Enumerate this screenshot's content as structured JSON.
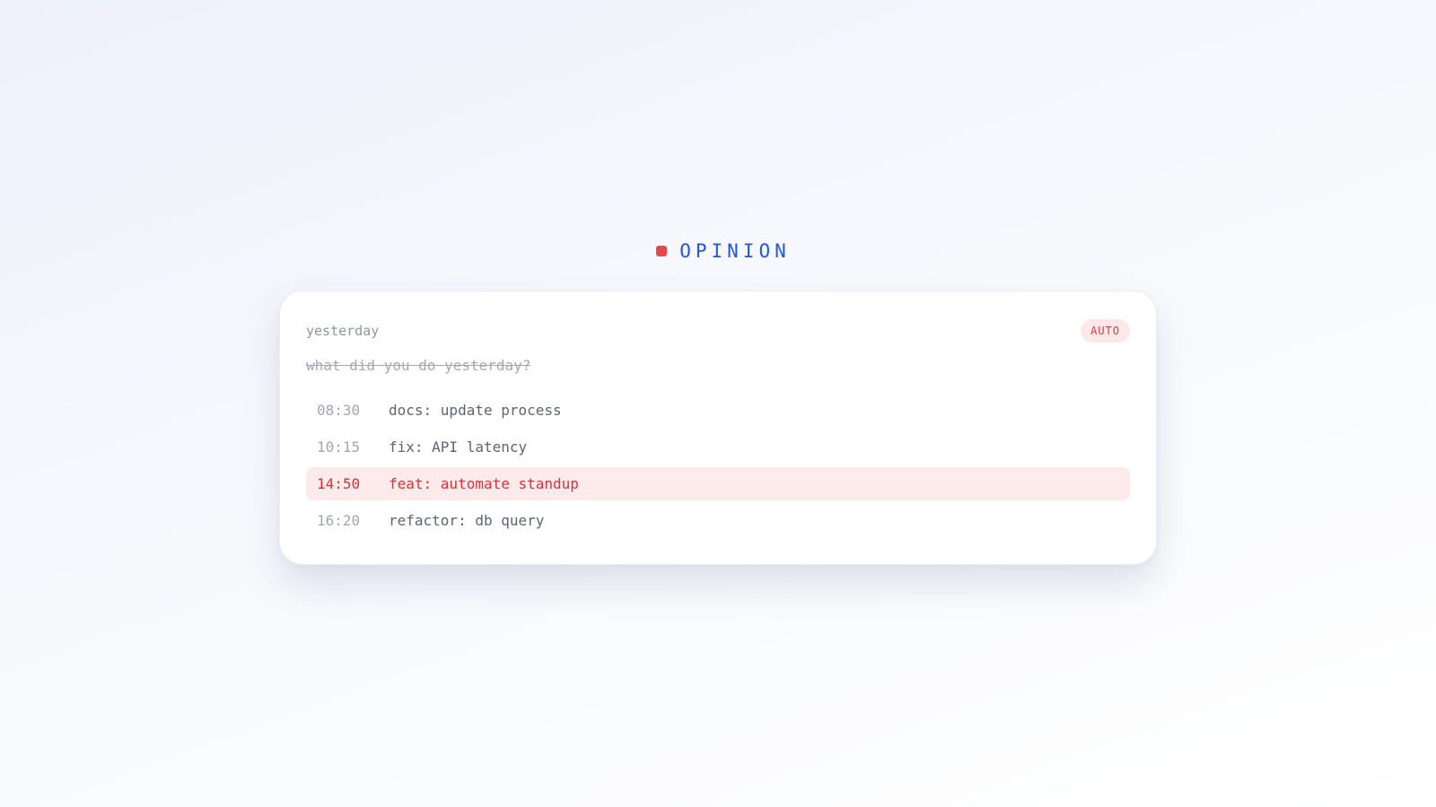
{
  "brand": {
    "name": "OPINION",
    "accent_color": "#e2484d",
    "text_color": "#2458d6"
  },
  "card": {
    "label": "yesterday",
    "badge": "AUTO",
    "question": "what did you do yesterday?",
    "entries": [
      {
        "time": "08:30",
        "message": "docs: update process",
        "highlighted": false
      },
      {
        "time": "10:15",
        "message": "fix: API latency",
        "highlighted": false
      },
      {
        "time": "14:50",
        "message": "feat: automate standup",
        "highlighted": true
      },
      {
        "time": "16:20",
        "message": "refactor: db query",
        "highlighted": false
      }
    ],
    "highlight_color": "#d2353b",
    "highlight_background": "#fdeaea"
  }
}
